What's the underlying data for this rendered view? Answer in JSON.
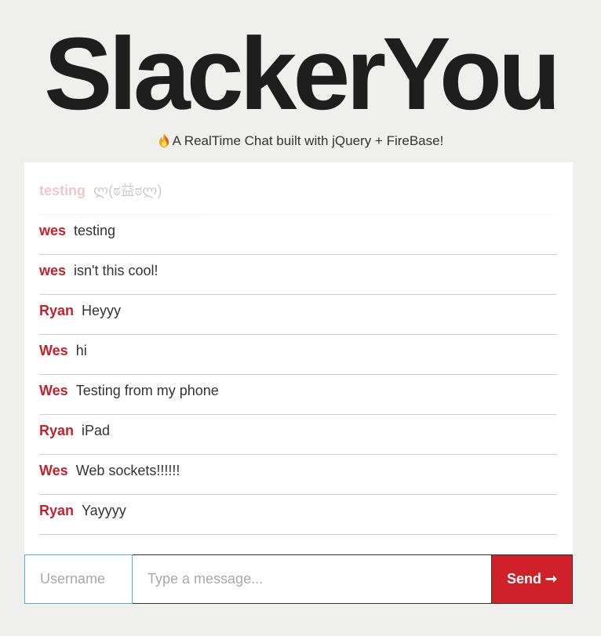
{
  "header": {
    "title": "SlackerYou",
    "subtitle": "A RealTime Chat built with jQuery + FireBase!",
    "subtitle_icon": "fire-icon"
  },
  "messages": [
    {
      "user": "testing",
      "text": "ლ(ಠ益ಠლ)",
      "faded": true
    },
    {
      "user": "wes",
      "text": "testing"
    },
    {
      "user": "wes",
      "text": "isn't this cool!"
    },
    {
      "user": "Ryan",
      "text": "Heyyy"
    },
    {
      "user": "Wes",
      "text": "hi"
    },
    {
      "user": "Wes",
      "text": "Testing from my phone"
    },
    {
      "user": "Ryan",
      "text": "iPad"
    },
    {
      "user": "Wes",
      "text": "Web sockets!!!!!!"
    },
    {
      "user": "Ryan",
      "text": "Yayyyy"
    }
  ],
  "form": {
    "username_placeholder": "Username",
    "username_value": "",
    "message_placeholder": "Type a message...",
    "message_value": "",
    "send_label": "Send ➞"
  },
  "colors": {
    "background": "#efefed",
    "accent": "#d0202a",
    "username": "#c8202b",
    "focus_border": "#55aecd"
  }
}
